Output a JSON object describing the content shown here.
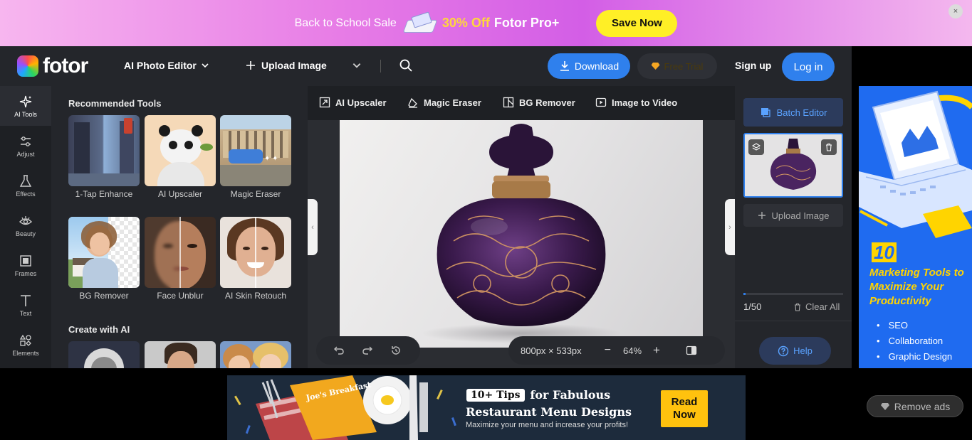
{
  "promo": {
    "text": "Back to School Sale",
    "offer": "30% Off",
    "product": "Fotor Pro+",
    "cta": "Save Now",
    "close": "×"
  },
  "nav": {
    "logo": "fotor",
    "editor_menu": "AI Photo Editor",
    "upload": "Upload Image",
    "download": "Download",
    "free_trial": "Free Trial",
    "signup": "Sign up",
    "login": "Log in"
  },
  "rail": {
    "items": [
      {
        "label": "AI Tools",
        "icon": "sparkle-icon"
      },
      {
        "label": "Adjust",
        "icon": "sliders-icon"
      },
      {
        "label": "Effects",
        "icon": "flask-icon"
      },
      {
        "label": "Beauty",
        "icon": "eye-icon"
      },
      {
        "label": "Frames",
        "icon": "frame-icon"
      },
      {
        "label": "Text",
        "icon": "text-icon"
      },
      {
        "label": "Elements",
        "icon": "shapes-icon"
      }
    ]
  },
  "tools": {
    "recommended_title": "Recommended Tools",
    "recommended": [
      {
        "label": "1-Tap Enhance"
      },
      {
        "label": "AI Upscaler"
      },
      {
        "label": "Magic Eraser"
      },
      {
        "label": "BG Remover"
      },
      {
        "label": "Face Unblur"
      },
      {
        "label": "AI Skin Retouch"
      }
    ],
    "create_title": "Create with AI"
  },
  "toolbar": {
    "items": [
      {
        "label": "AI Upscaler"
      },
      {
        "label": "Magic Eraser"
      },
      {
        "label": "BG Remover"
      },
      {
        "label": "Image to Video"
      }
    ]
  },
  "canvas": {
    "size": "800px × 533px",
    "zoom": "64%",
    "minus": "−",
    "plus": "+"
  },
  "right_panel": {
    "batch_editor": "Batch Editor",
    "upload": "Upload Image",
    "count": "1/50",
    "clear_all": "Clear All",
    "help": "Help",
    "progress": 0.02
  },
  "right_ad": {
    "number": "10",
    "headline": "Marketing Tools to Maximize Your Productivity",
    "bullets": [
      "SEO",
      "Collaboration",
      "Graphic Design"
    ]
  },
  "bottom_ad": {
    "tips": "10+ Tips",
    "line1": "for Fabulous",
    "line2": "Restaurant Menu Designs",
    "sub": "Maximize your menu and increase your profits!",
    "menu_title": "Joe's Breakfast",
    "cta_line1": "Read",
    "cta_line2": "Now"
  },
  "remove_ads": "Remove ads",
  "colors": {
    "accent": "#2f80ed",
    "promo_cta": "#ffef26",
    "dark_bg": "#24262b"
  }
}
